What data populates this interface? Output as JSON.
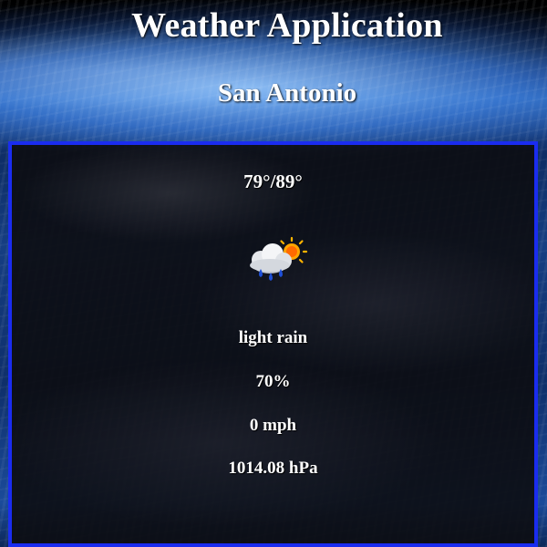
{
  "app": {
    "title": "Weather Application"
  },
  "location": {
    "city": "San Antonio"
  },
  "weather": {
    "temp_range": "79°/89°",
    "icon": "cloud-rain-sun-icon",
    "description": "light rain",
    "humidity": "70%",
    "wind": "0 mph",
    "pressure": "1014.08 hPa"
  },
  "colors": {
    "card_border": "#1a2cf0",
    "text": "#ffffff"
  }
}
